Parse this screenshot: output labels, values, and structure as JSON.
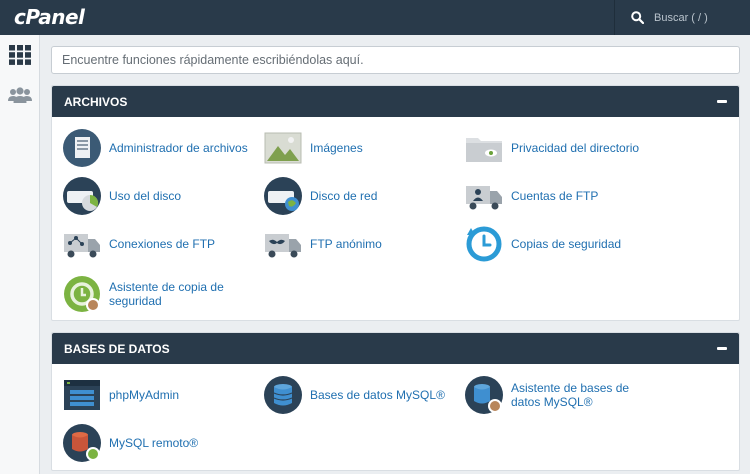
{
  "header": {
    "logo_text": "cPanel",
    "search_label": "Buscar ( / )"
  },
  "rail": {
    "items": [
      {
        "name": "apps-grid-icon"
      },
      {
        "name": "users-icon"
      }
    ]
  },
  "quick_search": {
    "placeholder": "Encuentre funciones rápidamente escribiéndolas aquí."
  },
  "sections": [
    {
      "title": "ARCHIVOS",
      "items": [
        {
          "label": "Administrador de archivos",
          "icon": "file-manager-icon"
        },
        {
          "label": "Imágenes",
          "icon": "images-icon"
        },
        {
          "label": "Privacidad del directorio",
          "icon": "directory-privacy-icon"
        },
        {
          "label": "Uso del disco",
          "icon": "disk-usage-icon"
        },
        {
          "label": "Disco de red",
          "icon": "network-disk-icon"
        },
        {
          "label": "Cuentas de FTP",
          "icon": "ftp-accounts-icon"
        },
        {
          "label": "Conexiones de FTP",
          "icon": "ftp-connections-icon"
        },
        {
          "label": "FTP anónimo",
          "icon": "anonymous-ftp-icon"
        },
        {
          "label": "Copias de seguridad",
          "icon": "backup-icon"
        },
        {
          "label": "Asistente de copia de seguridad",
          "icon": "backup-wizard-icon"
        }
      ]
    },
    {
      "title": "BASES DE DATOS",
      "items": [
        {
          "label": "phpMyAdmin",
          "icon": "phpmyadmin-icon"
        },
        {
          "label": "Bases de datos MySQL®",
          "icon": "mysql-databases-icon"
        },
        {
          "label": "Asistente de bases de datos MySQL®",
          "icon": "mysql-wizard-icon"
        },
        {
          "label": "MySQL remoto®",
          "icon": "remote-mysql-icon"
        }
      ]
    }
  ],
  "colors": {
    "header_bg": "#293a4a",
    "link": "#1f6fb0",
    "icon_navy": "#2b4257",
    "icon_green": "#7cb342",
    "icon_blue": "#2b9bd6"
  }
}
